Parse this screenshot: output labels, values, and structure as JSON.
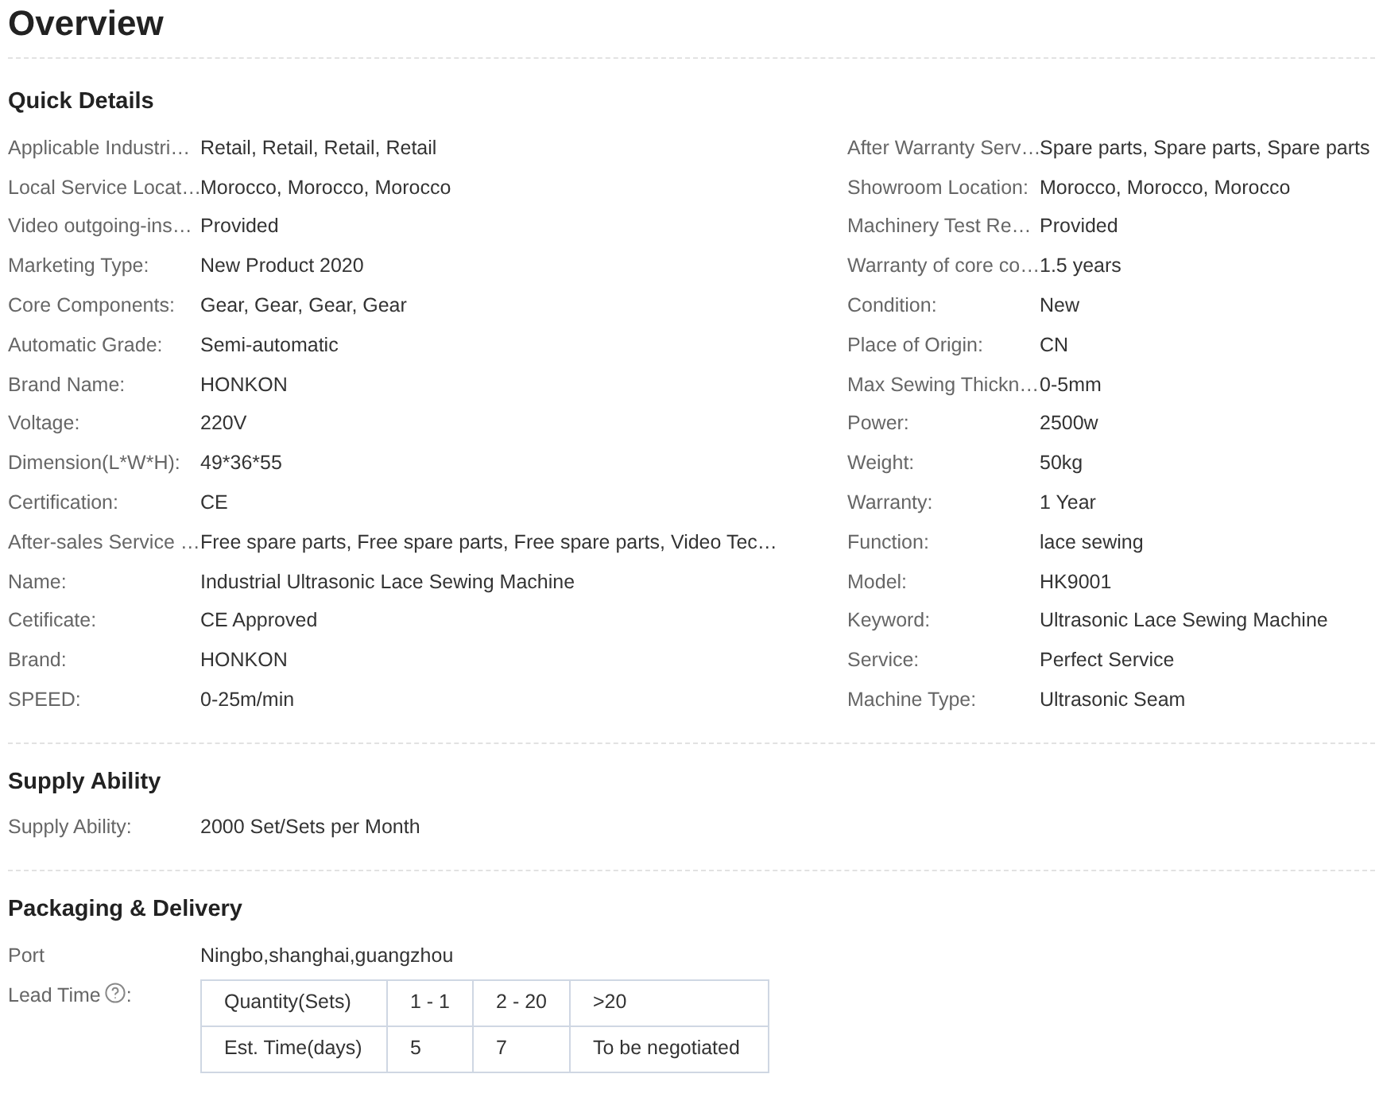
{
  "title": "Overview",
  "quick_details": {
    "heading": "Quick Details",
    "left_column": [
      {
        "label": "Applicable Industri…",
        "value": "Retail, Retail, Retail, Retail"
      },
      {
        "label": "Local Service Locat…",
        "value": "Morocco, Morocco, Morocco"
      },
      {
        "label": "Video outgoing-ins…",
        "value": "Provided"
      },
      {
        "label": "Marketing Type:",
        "value": "New Product 2020"
      },
      {
        "label": "Core Components:",
        "value": "Gear, Gear, Gear, Gear"
      },
      {
        "label": "Automatic Grade:",
        "value": "Semi-automatic"
      },
      {
        "label": "Brand Name:",
        "value": "HONKON"
      },
      {
        "label": "Voltage:",
        "value": "220V"
      },
      {
        "label": "Dimension(L*W*H):",
        "value": "49*36*55"
      },
      {
        "label": "Certification:",
        "value": "CE"
      },
      {
        "label": "After-sales Service …",
        "value": "Free spare parts, Free spare parts, Free spare parts, Video Tec…"
      },
      {
        "label": "Name:",
        "value": "Industrial Ultrasonic Lace Sewing Machine"
      },
      {
        "label": "Cetificate:",
        "value": "CE Approved"
      },
      {
        "label": "Brand:",
        "value": "HONKON"
      },
      {
        "label": "SPEED:",
        "value": "0-25m/min"
      }
    ],
    "right_column": [
      {
        "label": "After Warranty Serv…",
        "value": "Spare parts, Spare parts, Spare parts"
      },
      {
        "label": "Showroom Location:",
        "value": "Morocco, Morocco, Morocco"
      },
      {
        "label": "Machinery Test Re…",
        "value": "Provided"
      },
      {
        "label": "Warranty of core co…",
        "value": "1.5 years"
      },
      {
        "label": "Condition:",
        "value": "New"
      },
      {
        "label": "Place of Origin:",
        "value": "CN"
      },
      {
        "label": "Max Sewing Thickn…",
        "value": "0-5mm"
      },
      {
        "label": "Power:",
        "value": "2500w"
      },
      {
        "label": "Weight:",
        "value": "50kg"
      },
      {
        "label": "Warranty:",
        "value": "1 Year"
      },
      {
        "label": "Function:",
        "value": "lace sewing"
      },
      {
        "label": "Model:",
        "value": "HK9001"
      },
      {
        "label": "Keyword:",
        "value": "Ultrasonic Lace Sewing Machine"
      },
      {
        "label": "Service:",
        "value": "Perfect Service"
      },
      {
        "label": "Machine Type:",
        "value": "Ultrasonic Seam"
      }
    ]
  },
  "supply_ability": {
    "heading": "Supply Ability",
    "rows": [
      {
        "label": "Supply Ability:",
        "value": "2000 Set/Sets per Month"
      }
    ]
  },
  "packaging_delivery": {
    "heading": "Packaging & Delivery",
    "port": {
      "label": "Port",
      "value": "Ningbo,shanghai,guangzhou"
    },
    "lead_time": {
      "label": "Lead Time",
      "suffix": ":",
      "rows": [
        [
          "Quantity(Sets)",
          "1 - 1",
          "2 - 20",
          ">20"
        ],
        [
          "Est. Time(days)",
          "5",
          "7",
          "To be negotiated"
        ]
      ]
    }
  }
}
